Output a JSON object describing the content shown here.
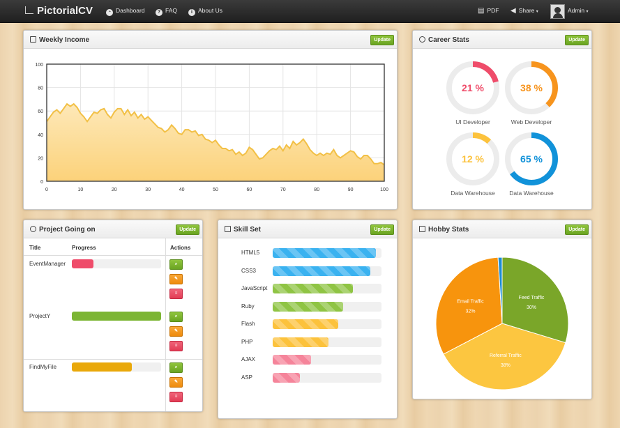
{
  "navbar": {
    "brand": "PictorialCV",
    "dashboard": "Dashboard",
    "faq": "FAQ",
    "about": "About Us",
    "pdf": "PDF",
    "share": "Share",
    "admin": "Admin"
  },
  "update_label": "Update",
  "weekly_income": {
    "title": "Weekly Income",
    "chart_data": {
      "type": "area",
      "title": "",
      "xlabel": "",
      "ylabel": "",
      "xlim": [
        0,
        100
      ],
      "ylim": [
        0,
        100
      ],
      "xticks": [
        "0",
        "10",
        "20",
        "30",
        "40",
        "50",
        "60",
        "70",
        "80",
        "90",
        "100"
      ],
      "yticks": [
        "0",
        "20",
        "40",
        "60",
        "80",
        "100"
      ],
      "grid": true,
      "x": [
        0,
        1,
        2,
        3,
        4,
        5,
        6,
        7,
        8,
        9,
        10,
        11,
        12,
        13,
        14,
        15,
        16,
        17,
        18,
        19,
        20,
        21,
        22,
        23,
        24,
        25,
        26,
        27,
        28,
        29,
        30,
        31,
        32,
        33,
        34,
        35,
        36,
        37,
        38,
        39,
        40,
        41,
        42,
        43,
        44,
        45,
        46,
        47,
        48,
        49,
        50,
        51,
        52,
        53,
        54,
        55,
        56,
        57,
        58,
        59,
        60,
        61,
        62,
        63,
        64,
        65,
        66,
        67,
        68,
        69,
        70,
        71,
        72,
        73,
        74,
        75,
        76,
        77,
        78,
        79,
        80,
        81,
        82,
        83,
        84,
        85,
        86,
        87,
        88,
        89,
        90,
        91,
        92,
        93,
        94,
        95,
        96,
        97,
        98,
        99,
        100
      ],
      "y": [
        51,
        55,
        59,
        61,
        58,
        62,
        66,
        64,
        66,
        63,
        58,
        55,
        51,
        55,
        59,
        58,
        61,
        62,
        57,
        54,
        59,
        62,
        62,
        57,
        61,
        56,
        59,
        54,
        57,
        53,
        55,
        52,
        49,
        46,
        45,
        42,
        44,
        48,
        45,
        41,
        40,
        44,
        44,
        42,
        43,
        39,
        40,
        36,
        35,
        33,
        35,
        31,
        28,
        28,
        26,
        27,
        23,
        25,
        22,
        24,
        29,
        27,
        23,
        19,
        20,
        23,
        26,
        28,
        27,
        30,
        26,
        31,
        28,
        34,
        31,
        33,
        36,
        32,
        27,
        24,
        22,
        24,
        22,
        24,
        23,
        27,
        22,
        20,
        22,
        24,
        26,
        25,
        21,
        19,
        22,
        22,
        19,
        15,
        15,
        16,
        14
      ]
    }
  },
  "career_stats": {
    "title": "Career Stats",
    "items": [
      {
        "label": "UI Developer",
        "value": "21",
        "percent": 21,
        "color": "#ef4c6a"
      },
      {
        "label": "Web Developer",
        "value": "38",
        "percent": 38,
        "color": "#f7941d"
      },
      {
        "label": "Data Warehouse",
        "value": "12",
        "percent": 12,
        "color": "#fcc23c"
      },
      {
        "label": "Data Warehouse",
        "value": "65",
        "percent": 65,
        "color": "#1192d9"
      }
    ],
    "percent_sign": "%"
  },
  "projects": {
    "title": "Project Going on",
    "columns": [
      "Title",
      "Progress",
      "Actions"
    ],
    "rows": [
      {
        "title": "EventManager",
        "progress": 24,
        "color": "#ef4c6a"
      },
      {
        "title": "ProjectY",
        "progress": 100,
        "color": "#7cb534"
      },
      {
        "title": "FindMyFile",
        "progress": 67,
        "color": "#e9a80a"
      }
    ]
  },
  "skills": {
    "title": "Skill Set",
    "items": [
      {
        "label": "HTML5",
        "value": 95,
        "color": "#3ab2f0"
      },
      {
        "label": "CSS3",
        "value": 90,
        "color": "#3ab2f0"
      },
      {
        "label": "JavaScript",
        "value": 74,
        "color": "#8fc444"
      },
      {
        "label": "Ruby",
        "value": 65,
        "color": "#8fc444"
      },
      {
        "label": "Flash",
        "value": 60,
        "color": "#fcc23c"
      },
      {
        "label": "PHP",
        "value": 51,
        "color": "#fcc23c"
      },
      {
        "label": "AJAX",
        "value": 35,
        "color": "#f5849a"
      },
      {
        "label": "ASP",
        "value": 25,
        "color": "#f5849a"
      }
    ]
  },
  "hobby_stats": {
    "title": "Hobby Stats",
    "chart_data": {
      "type": "pie",
      "title": "",
      "slices": [
        {
          "name": "Feed Traffic",
          "value": 30,
          "label": "30%",
          "color": "#7aa629"
        },
        {
          "name": "Referral Traffic",
          "value": 38,
          "label": "38%",
          "color": "#fcc640"
        },
        {
          "name": "Email Traffic",
          "value": 32,
          "label": "32%",
          "color": "#f7940d"
        },
        {
          "name": "",
          "value": 1,
          "label": "",
          "color": "#1c8cd2"
        }
      ]
    }
  }
}
